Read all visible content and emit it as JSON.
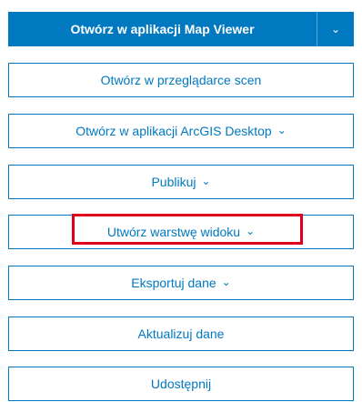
{
  "primary": {
    "label": "Otwórz w aplikacji Map Viewer",
    "dropdown_icon": "chevron-down-icon"
  },
  "buttons": [
    {
      "label": "Otwórz w przeglądarce scen",
      "has_menu": false
    },
    {
      "label": "Otwórz w aplikacji ArcGIS Desktop",
      "has_menu": true
    },
    {
      "label": "Publikuj",
      "has_menu": true
    },
    {
      "label": "Utwórz warstwę widoku",
      "has_menu": true
    },
    {
      "label": "Eksportuj dane",
      "has_menu": true
    },
    {
      "label": "Aktualizuj dane",
      "has_menu": false
    },
    {
      "label": "Udostępnij",
      "has_menu": false
    }
  ],
  "colors": {
    "accent": "#0079c1",
    "highlight": "#e0001b"
  }
}
